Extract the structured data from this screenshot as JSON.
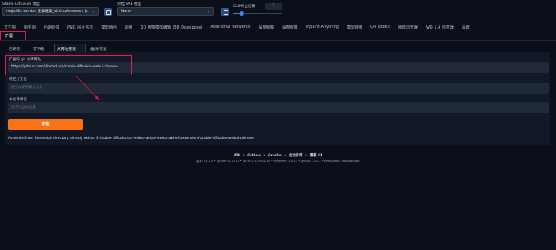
{
  "top": {
    "sd_model_label": "Stable Diffusion 模型",
    "sd_model_value": "majicMix sombre 麦橘唯美_v1.0.safetensors [c",
    "vae_label": "外挂 VAE 模型",
    "vae_value": "None",
    "clip_label": "CLIP终止层数",
    "clip_value": "3"
  },
  "tabs": [
    "文生图",
    "图生图",
    "后期处理",
    "PNG 图片信息",
    "模型融合",
    "训练",
    "3D 骨架模型编辑 (3D Openpose)",
    "Additional Networks",
    "深度图库",
    "深度图像",
    "Inpaint Anything",
    "模型转换",
    "QR Toolkit",
    "图库浏览器",
    "WD 1.4 标签器",
    "设置"
  ],
  "extensions_tab": "扩展",
  "subtabs": [
    "已安装",
    "可下载",
    "从网址安装",
    "备份/恢复"
  ],
  "install": {
    "url_label": "扩展的 git 仓库网址",
    "url_value": "https://github.com/VinsonLaro/stable-diffusion-webui-chinese",
    "branch_label": "特定分支名",
    "branch_placeholder": "留空以使用默认分支",
    "dir_label": "本地目录名",
    "dir_placeholder": "留空时自动生成",
    "install_button": "安装"
  },
  "error_text": "AssertionError: Extension directory already exists: E:\\stable diffusion\\sd-webui-aki\\sd-webui-aki-v4\\extensions\\stable-diffusion-webui-chinese",
  "footer": {
    "links": [
      "API",
      "Github",
      "Gradio",
      "启动计时",
      "重载 UI"
    ],
    "version": "版本: v1.3.2  •  python: 3.10.11  •  torch: 2.0.0+cu118  •  xformers: 0.0.17  •  gradio: 3.41.2  •  checkpoint: c8b4848ab6"
  },
  "colors": {
    "background": "#0b0f19",
    "card": "#111827",
    "field": "#1f2937",
    "accent_orange": "#f97316",
    "annotation_red": "#e11d48"
  },
  "icons": [
    "refresh-icon",
    "chevron-down-icon"
  ]
}
